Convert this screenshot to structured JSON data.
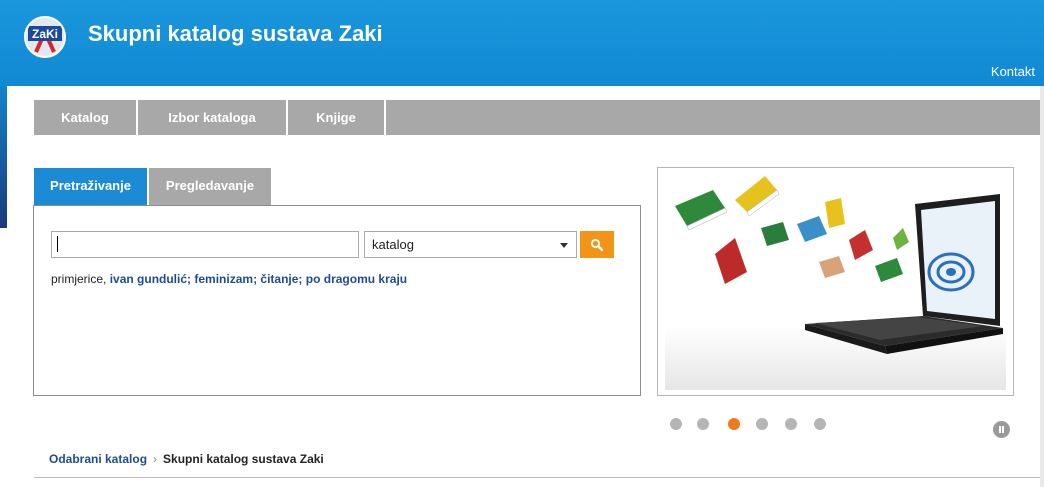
{
  "header": {
    "title": "Skupni katalog sustava Zaki",
    "logo_text": "ZaKi",
    "kontakt_label": "Kontakt"
  },
  "nav": {
    "items": [
      {
        "label": "Katalog"
      },
      {
        "label": "Izbor kataloga"
      },
      {
        "label": "Knjige"
      }
    ]
  },
  "search": {
    "tabs": [
      {
        "label": "Pretraživanje",
        "active": true
      },
      {
        "label": "Pregledavanje",
        "active": false
      }
    ],
    "input_value": "",
    "select_value": "katalog",
    "button_icon": "search-icon",
    "examples_prefix": "primjerice,",
    "examples": [
      "ivan gundulić",
      "feminizam",
      "čitanje",
      "po dragomu kraju"
    ]
  },
  "slider": {
    "dot_count": 6,
    "active_dot_index": 2,
    "pause_icon": "pause-icon"
  },
  "breadcrumb": {
    "link_label": "Odabrani katalog",
    "current_label": "Skupni katalog sustava Zaki"
  },
  "colors": {
    "header_blue": "#1189d2",
    "active_tab": "#1b8bd6",
    "nav_gray": "#a8a8a8",
    "search_button": "#f29418",
    "active_dot": "#f07b1a",
    "link": "#1f4b93"
  }
}
